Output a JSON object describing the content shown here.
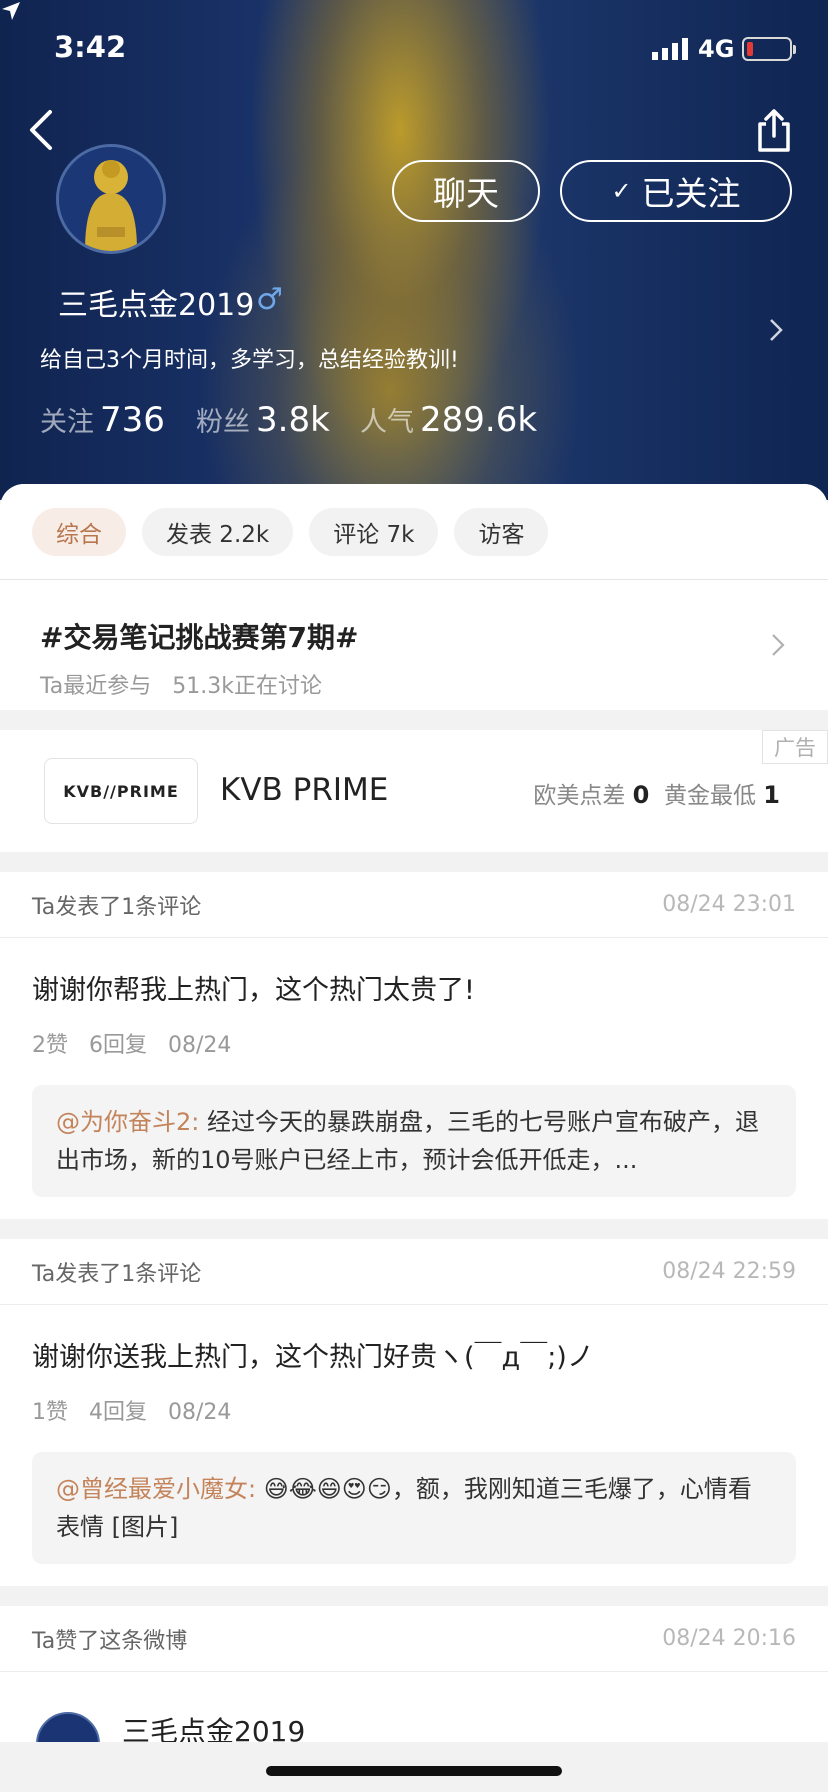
{
  "status": {
    "time": "3:42",
    "network": "4G"
  },
  "profile": {
    "username": "三毛点金2019",
    "gender": "♂",
    "bio": "给自己3个月时间，多学习，总结经验教训!",
    "chat_label": "聊天",
    "follow_check": "✓",
    "follow_label": "已关注",
    "stats": {
      "follow_label": "关注",
      "follow_value": "736",
      "fans_label": "粉丝",
      "fans_value": "3.8k",
      "pop_label": "人气",
      "pop_value": "289.6k"
    }
  },
  "tabs": [
    {
      "label": "综合"
    },
    {
      "label": "发表 2.2k"
    },
    {
      "label": "评论 7k"
    },
    {
      "label": "访客"
    }
  ],
  "topic": {
    "title": "#交易笔记挑战赛第7期#",
    "prefix": "Ta最近参与",
    "discussion": "51.3k正在讨论"
  },
  "ad": {
    "tag": "广告",
    "logo_text": "KVB//PRIME",
    "name": "KVB PRIME",
    "rate1_label": "欧美点差",
    "rate1_value": "0",
    "rate2_label": "黄金最低",
    "rate2_value": "1"
  },
  "feed": [
    {
      "head": "Ta发表了1条评论",
      "time": "08/24 23:01",
      "text": "谢谢你帮我上热门，这个热门太贵了!",
      "meta": "2赞   6回复   08/24",
      "quote_user": "@为你奋斗2:",
      "quote_text": " 经过今天的暴跌崩盘，三毛的七号账户宣布破产，退出市场，新的10号账户已经上市，预计会低开低走，..."
    },
    {
      "head": "Ta发表了1条评论",
      "time": "08/24 22:59",
      "text": "谢谢你送我上热门，这个热门好贵ヽ(￣д￣;)ノ",
      "meta": "1赞   4回复   08/24",
      "quote_user": "@曾经最爱小魔女:",
      "quote_text": " 😅😂😄😍😏，额，我刚知道三毛爆了，心情看表情 [图片]"
    }
  ],
  "liked": {
    "head": "Ta赞了这条微博",
    "time": "08/24 20:16",
    "name": "三毛点金2019"
  }
}
